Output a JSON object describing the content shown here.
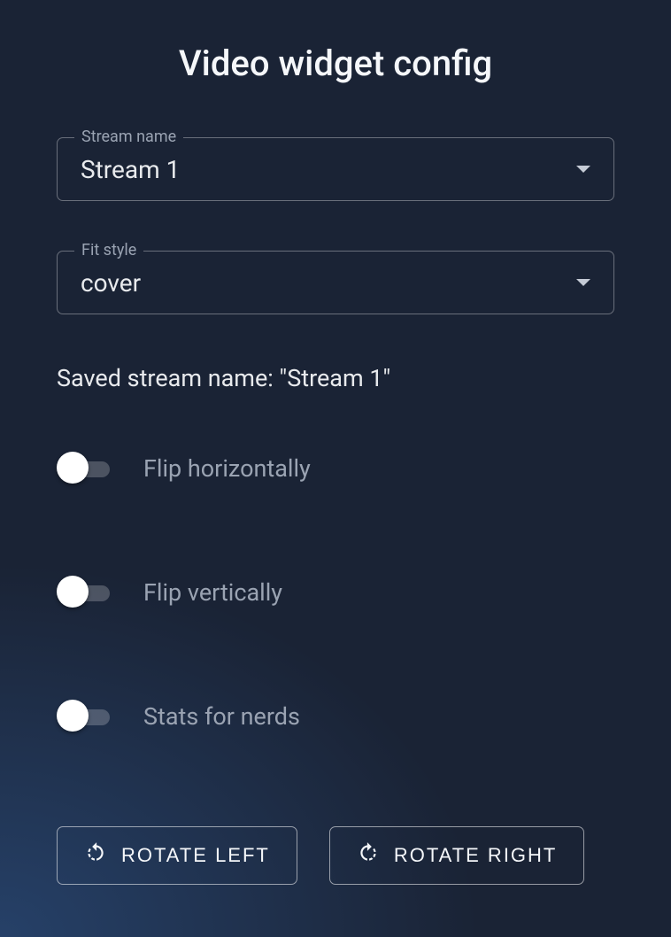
{
  "title": "Video widget config",
  "fields": {
    "stream_name": {
      "label": "Stream name",
      "value": "Stream 1"
    },
    "fit_style": {
      "label": "Fit style",
      "value": "cover"
    }
  },
  "saved_label_prefix": "Saved stream name: \"",
  "saved_value": "Stream 1",
  "saved_label_suffix": "\"",
  "toggles": {
    "flip_h": {
      "label": "Flip horizontally",
      "checked": false
    },
    "flip_v": {
      "label": "Flip vertically",
      "checked": false
    },
    "stats": {
      "label": "Stats for nerds",
      "checked": false
    }
  },
  "buttons": {
    "rotate_left": "ROTATE LEFT",
    "rotate_right": "ROTATE RIGHT"
  }
}
